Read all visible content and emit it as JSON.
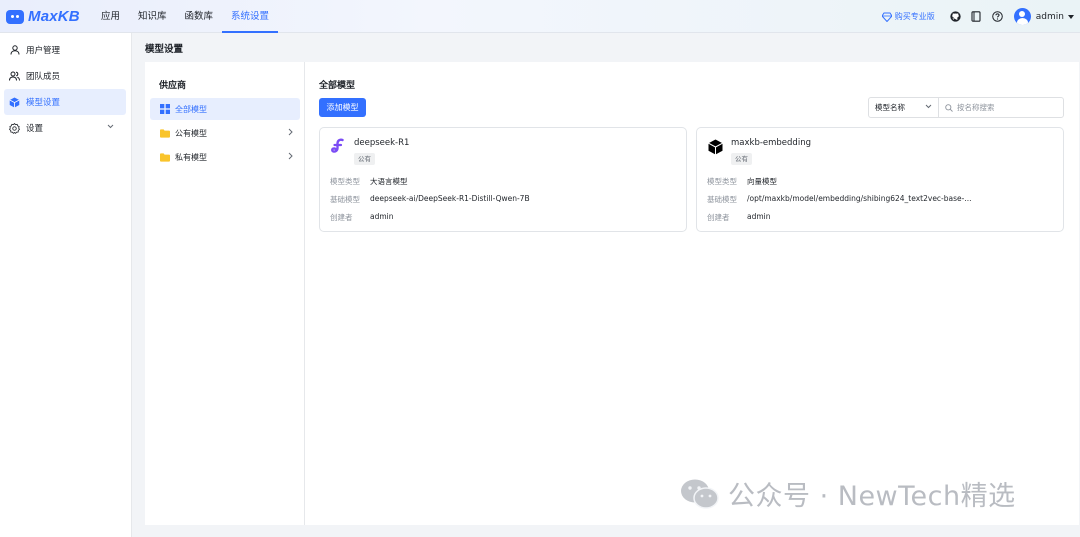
{
  "app": {
    "logo_text": "MaxKB"
  },
  "topnav": {
    "items": [
      {
        "label": "应用"
      },
      {
        "label": "知识库"
      },
      {
        "label": "函数库"
      },
      {
        "label": "系统设置"
      }
    ],
    "active_index": 3
  },
  "topright": {
    "buy_label": "购买专业版",
    "icons": [
      "github-icon",
      "book-icon",
      "help-icon"
    ],
    "username": "admin"
  },
  "sidebar": {
    "items": [
      {
        "label": "用户管理",
        "icon": "user-icon"
      },
      {
        "label": "团队成员",
        "icon": "team-icon"
      },
      {
        "label": "模型设置",
        "icon": "cube-icon",
        "active": true
      },
      {
        "label": "设置",
        "icon": "gear-icon",
        "expandable": true
      }
    ]
  },
  "page": {
    "title": "模型设置"
  },
  "providers": {
    "title": "供应商",
    "items": [
      {
        "label": "全部模型",
        "icon": "grid-icon",
        "active": true
      },
      {
        "label": "公有模型",
        "icon": "folder-icon"
      },
      {
        "label": "私有模型",
        "icon": "folder-icon"
      }
    ]
  },
  "models": {
    "title": "全部模型",
    "add_button": "添加模型",
    "filter": {
      "field": "模型名称",
      "placeholder": "按名称搜索"
    },
    "field_labels": {
      "type": "模型类型",
      "base": "基础模型",
      "creator": "创建者"
    },
    "cards": [
      {
        "name": "deepseek-R1",
        "icon": "deepseek-icon",
        "tag": "公有",
        "type": "大语言模型",
        "base": "deepseek-ai/DeepSeek-R1-Distill-Qwen-7B",
        "creator": "admin"
      },
      {
        "name": "maxkb-embedding",
        "icon": "cube-black-icon",
        "tag": "公有",
        "type": "向量模型",
        "base": "/opt/maxkb/model/embedding/shibing624_text2vec-base-...",
        "creator": "admin"
      }
    ]
  },
  "watermark": {
    "text": "公众号 · NewTech精选"
  },
  "colors": {
    "accent": "#3370ff",
    "folder": "#f9c42b"
  }
}
